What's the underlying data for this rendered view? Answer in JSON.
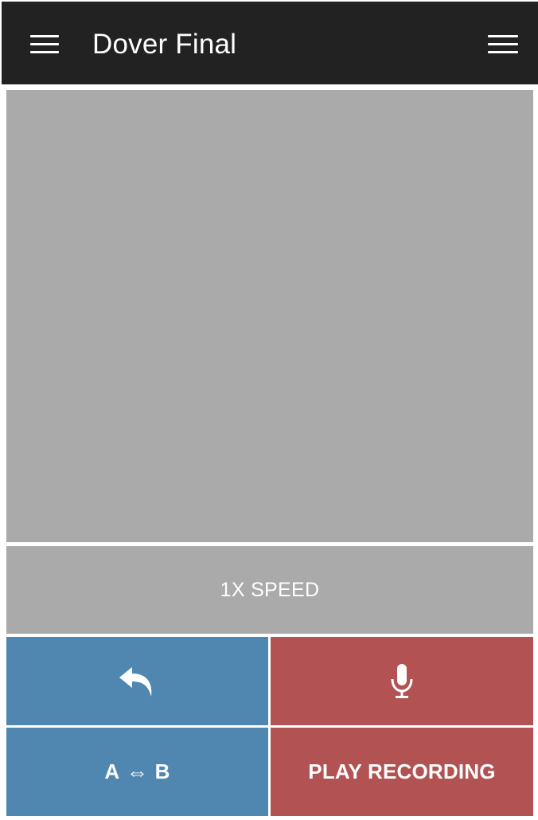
{
  "header": {
    "title": "Dover Final",
    "left_icon": "hamburger-icon",
    "right_icon": "menu-icon",
    "background": "#222222"
  },
  "canvas": {
    "background": "#aaaaaa"
  },
  "speed": {
    "label": "1X SPEED"
  },
  "controls": {
    "undo_icon": "undo-arrow-icon",
    "mic_icon": "microphone-icon",
    "swap": {
      "left": "A",
      "arrow": "⇔",
      "right": "B"
    },
    "play_label": "PLAY RECORDING",
    "blue_color": "#5087b1",
    "red_color": "#b25252"
  }
}
